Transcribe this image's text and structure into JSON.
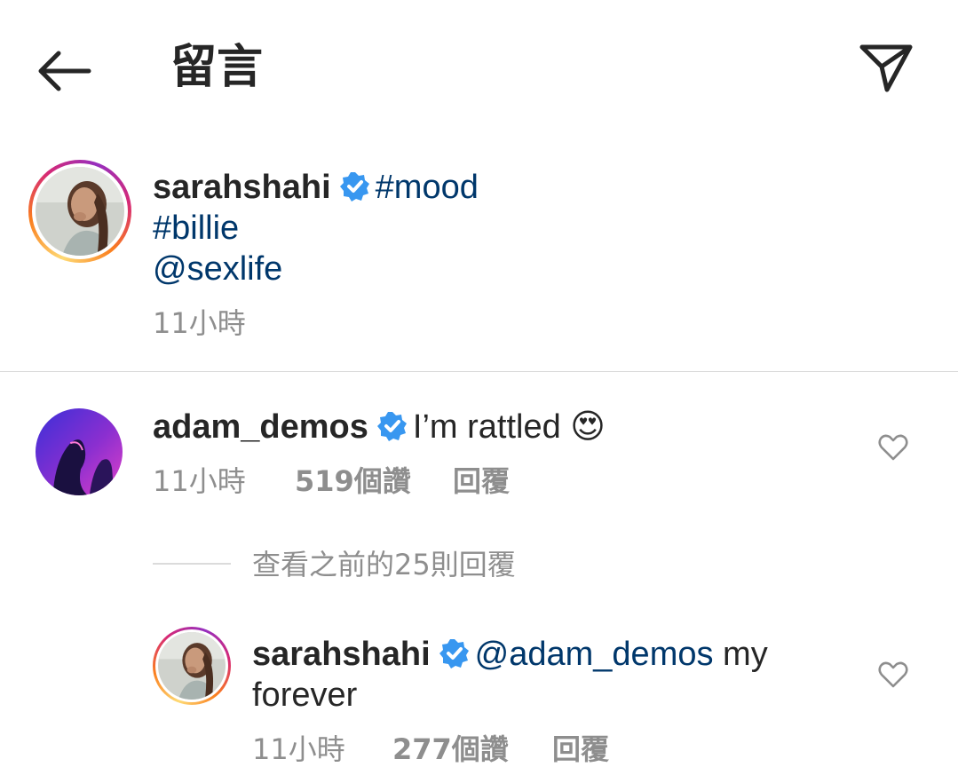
{
  "header": {
    "back_icon": "arrow-left-icon",
    "title": "留言",
    "share_icon": "paper-plane-icon"
  },
  "caption": {
    "username": "sarahshahi",
    "verified": true,
    "lines": [
      "#mood",
      "#billie",
      "@sexlife"
    ],
    "time": "11小時"
  },
  "comments": [
    {
      "username": "adam_demos",
      "verified": true,
      "text": "I’m rattled",
      "emoji": "😍",
      "time": "11小時",
      "likes": "519個讚",
      "reply": "回覆"
    }
  ],
  "view_replies": "查看之前的25則回覆",
  "reply": {
    "username": "sarahshahi",
    "verified": true,
    "mention": "@adam_demos",
    "text_1": " my",
    "text_2": "forever",
    "time": "11小時",
    "likes": "277個讚",
    "reply": "回覆"
  },
  "colors": {
    "verified_blue": "#3897f0",
    "link_blue": "#00376b",
    "muted": "#8e8e8e"
  }
}
